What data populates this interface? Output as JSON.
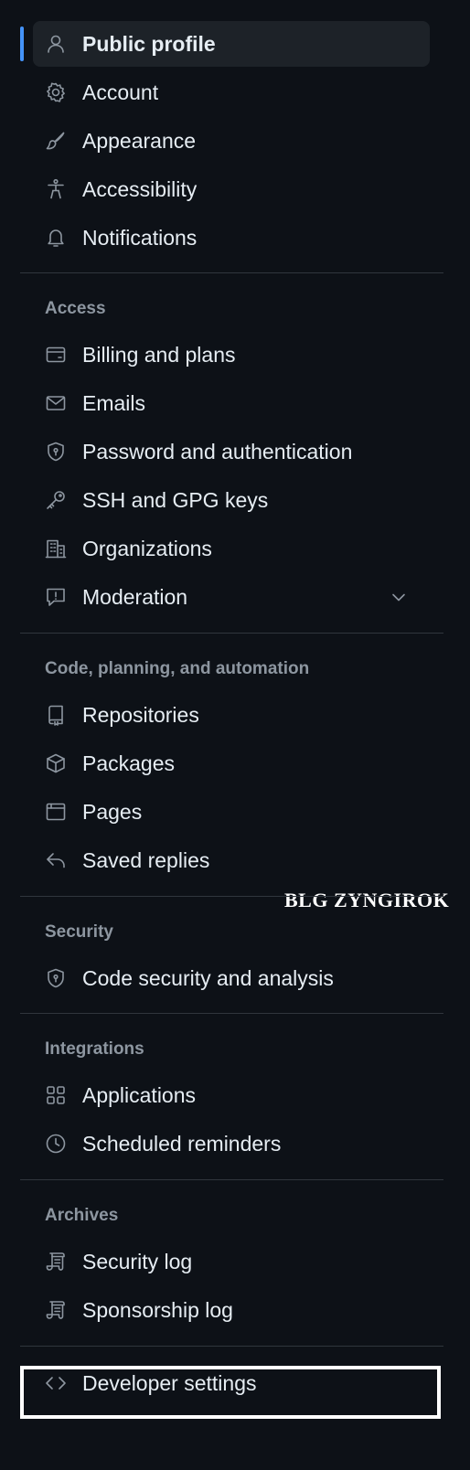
{
  "nav": {
    "top_items": [
      {
        "label": "Public profile",
        "icon": "person-icon",
        "active": true
      },
      {
        "label": "Account",
        "icon": "gear-icon"
      },
      {
        "label": "Appearance",
        "icon": "paintbrush-icon"
      },
      {
        "label": "Accessibility",
        "icon": "accessibility-icon"
      },
      {
        "label": "Notifications",
        "icon": "bell-icon"
      }
    ],
    "access": {
      "heading": "Access",
      "items": [
        {
          "label": "Billing and plans",
          "icon": "credit-card-icon"
        },
        {
          "label": "Emails",
          "icon": "mail-icon"
        },
        {
          "label": "Password and authentication",
          "icon": "shield-lock-icon"
        },
        {
          "label": "SSH and GPG keys",
          "icon": "key-icon"
        },
        {
          "label": "Organizations",
          "icon": "organization-icon"
        },
        {
          "label": "Moderation",
          "icon": "report-icon",
          "expandable": true
        }
      ]
    },
    "code": {
      "heading": "Code, planning, and automation",
      "items": [
        {
          "label": "Repositories",
          "icon": "repo-icon"
        },
        {
          "label": "Packages",
          "icon": "package-icon"
        },
        {
          "label": "Pages",
          "icon": "browser-icon"
        },
        {
          "label": "Saved replies",
          "icon": "reply-icon"
        }
      ]
    },
    "security": {
      "heading": "Security",
      "items": [
        {
          "label": "Code security and analysis",
          "icon": "shield-lock-icon"
        }
      ]
    },
    "integrations": {
      "heading": "Integrations",
      "items": [
        {
          "label": "Applications",
          "icon": "apps-icon"
        },
        {
          "label": "Scheduled reminders",
          "icon": "clock-icon"
        }
      ]
    },
    "archives": {
      "heading": "Archives",
      "items": [
        {
          "label": "Security log",
          "icon": "log-icon"
        },
        {
          "label": "Sponsorship log",
          "icon": "log-icon"
        }
      ]
    },
    "developer": {
      "label": "Developer settings",
      "icon": "code-icon"
    }
  },
  "watermark": "BLG ZYNGIROK",
  "colors": {
    "background": "#0d1117",
    "active_bg": "#1d2228",
    "accent": "#4493f8",
    "text": "#e6edf3",
    "muted": "#8d96a0",
    "divider": "#30363d",
    "highlight": "#ffffff"
  }
}
